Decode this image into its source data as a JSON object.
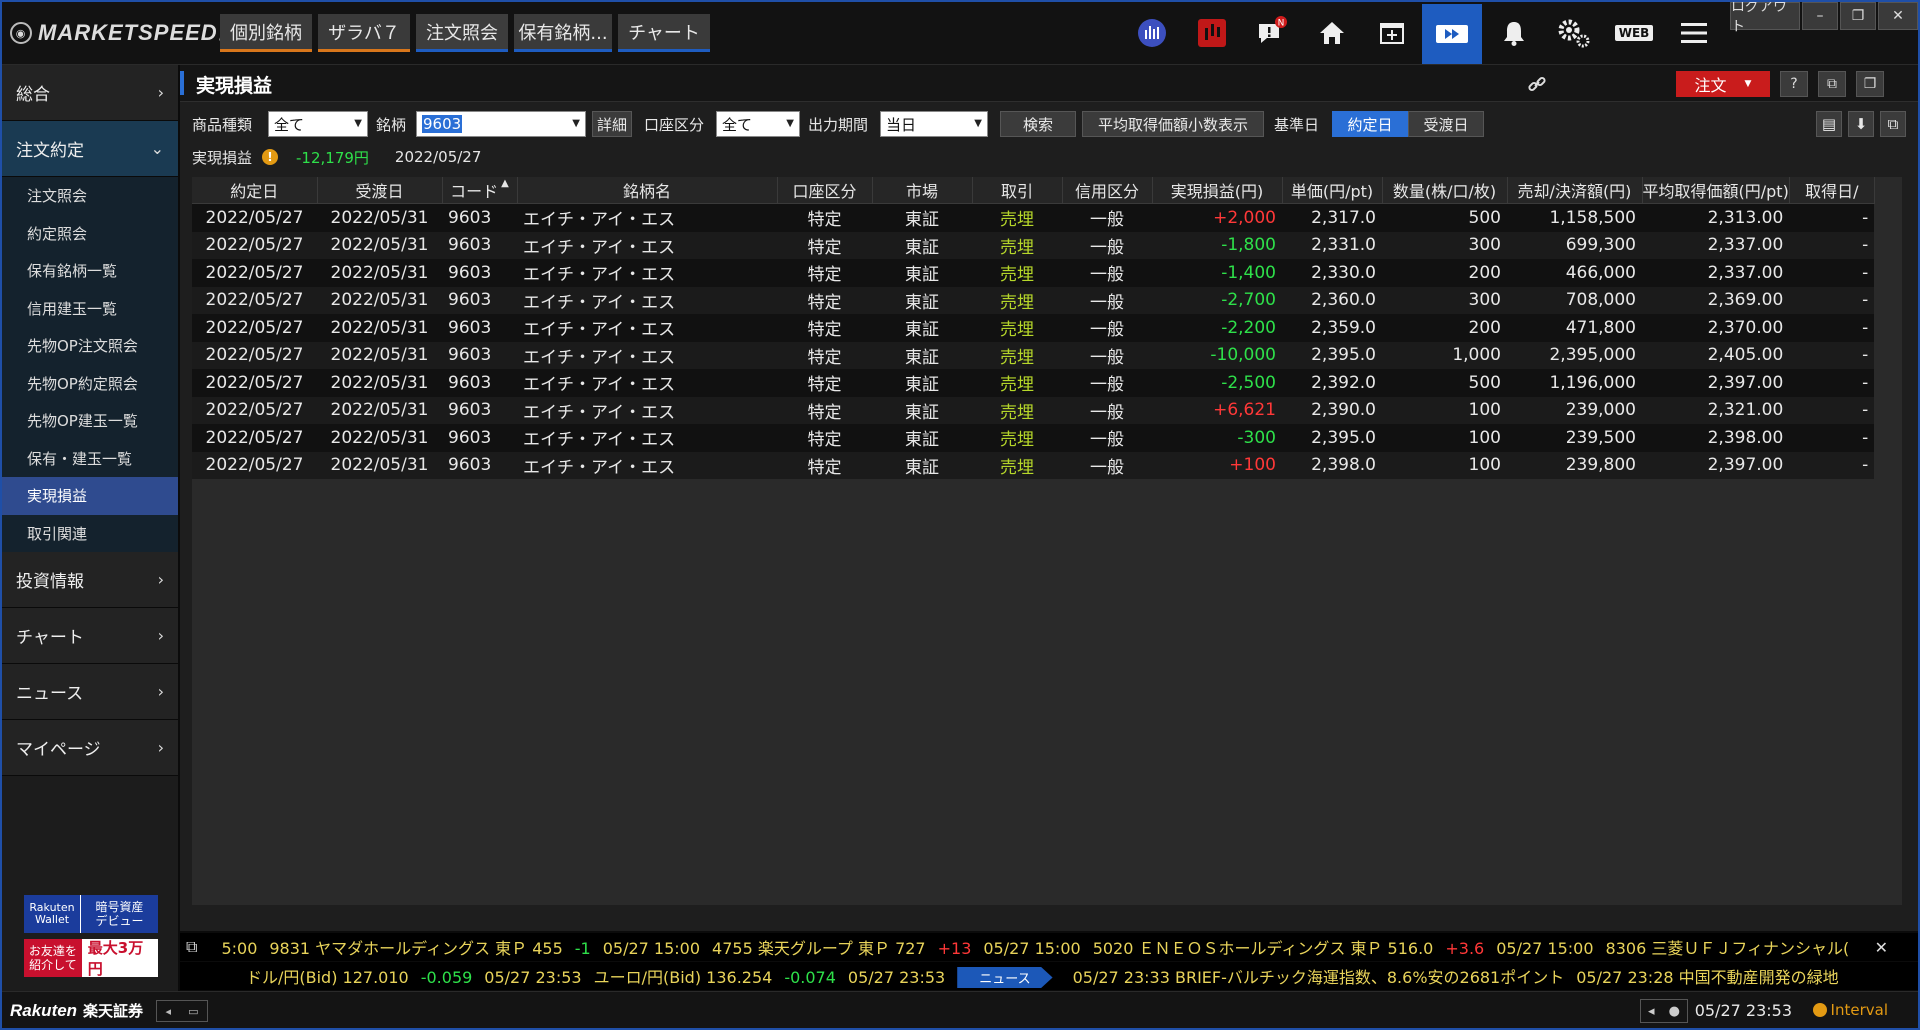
{
  "app": {
    "logo_text": "MARKETSPEEDⅡ",
    "tabs": [
      "個別銘柄",
      "ザラバ７",
      "注文照会",
      "保有銘柄...",
      "チャート"
    ],
    "logout_label": "ログアウト",
    "web_label": "WEB",
    "notification_badge": "N"
  },
  "sidebar": {
    "sections": [
      {
        "label": "総合"
      },
      {
        "label": "注文約定"
      },
      {
        "label": "投資情報"
      },
      {
        "label": "チャート"
      },
      {
        "label": "ニュース"
      },
      {
        "label": "マイページ"
      }
    ],
    "sub_items": [
      "注文照会",
      "約定照会",
      "保有銘柄一覧",
      "信用建玉一覧",
      "先物OP注文照会",
      "先物OP約定照会",
      "先物OP建玉一覧",
      "保有・建玉一覧",
      "実現損益",
      "取引関連"
    ],
    "active_sub": "実現損益",
    "banner1": {
      "brand_top": "Rakuten",
      "brand_bottom": "Wallet",
      "text_top": "暗号資産",
      "text_bottom": "デビュー"
    },
    "banner2": {
      "line1": "お友達を",
      "line2": "紹介して",
      "amount": "最大3万円"
    }
  },
  "panel": {
    "title": "実現損益",
    "order_button": "注文",
    "filters": {
      "product_label": "商品種類",
      "product_value": "全て",
      "symbol_label": "銘柄",
      "symbol_value": "9603",
      "detail_button": "詳細",
      "account_label": "口座区分",
      "account_value": "全て",
      "period_label": "出力期間",
      "period_value": "当日",
      "search_button": "検索",
      "avg_price_button": "平均取得価額小数表示",
      "base_date_label": "基準日",
      "trade_date_button": "約定日",
      "settle_date_button": "受渡日"
    },
    "summary": {
      "label": "実現損益",
      "value": "-12,179円",
      "date": "2022/05/27"
    }
  },
  "table": {
    "headers": [
      "約定日",
      "受渡日",
      "コード",
      "銘柄名",
      "口座区分",
      "市場",
      "取引",
      "信用区分",
      "実現損益(円)",
      "単価(円/pt)",
      "数量(株/口/枚)",
      "売却/決済額(円)",
      "平均取得価額(円/pt)",
      "取得日/"
    ],
    "rows": [
      [
        "2022/05/27",
        "2022/05/31",
        "9603",
        "エイチ・アイ・エス",
        "特定",
        "東証",
        "売埋",
        "一般",
        "+2,000",
        "2,317.0",
        "500",
        "1,158,500",
        "2,313.00",
        "-"
      ],
      [
        "2022/05/27",
        "2022/05/31",
        "9603",
        "エイチ・アイ・エス",
        "特定",
        "東証",
        "売埋",
        "一般",
        "-1,800",
        "2,331.0",
        "300",
        "699,300",
        "2,337.00",
        "-"
      ],
      [
        "2022/05/27",
        "2022/05/31",
        "9603",
        "エイチ・アイ・エス",
        "特定",
        "東証",
        "売埋",
        "一般",
        "-1,400",
        "2,330.0",
        "200",
        "466,000",
        "2,337.00",
        "-"
      ],
      [
        "2022/05/27",
        "2022/05/31",
        "9603",
        "エイチ・アイ・エス",
        "特定",
        "東証",
        "売埋",
        "一般",
        "-2,700",
        "2,360.0",
        "300",
        "708,000",
        "2,369.00",
        "-"
      ],
      [
        "2022/05/27",
        "2022/05/31",
        "9603",
        "エイチ・アイ・エス",
        "特定",
        "東証",
        "売埋",
        "一般",
        "-2,200",
        "2,359.0",
        "200",
        "471,800",
        "2,370.00",
        "-"
      ],
      [
        "2022/05/27",
        "2022/05/31",
        "9603",
        "エイチ・アイ・エス",
        "特定",
        "東証",
        "売埋",
        "一般",
        "-10,000",
        "2,395.0",
        "1,000",
        "2,395,000",
        "2,405.00",
        "-"
      ],
      [
        "2022/05/27",
        "2022/05/31",
        "9603",
        "エイチ・アイ・エス",
        "特定",
        "東証",
        "売埋",
        "一般",
        "-2,500",
        "2,392.0",
        "500",
        "1,196,000",
        "2,397.00",
        "-"
      ],
      [
        "2022/05/27",
        "2022/05/31",
        "9603",
        "エイチ・アイ・エス",
        "特定",
        "東証",
        "売埋",
        "一般",
        "+6,621",
        "2,390.0",
        "100",
        "239,000",
        "2,321.00",
        "-"
      ],
      [
        "2022/05/27",
        "2022/05/31",
        "9603",
        "エイチ・アイ・エス",
        "特定",
        "東証",
        "売埋",
        "一般",
        "-300",
        "2,395.0",
        "100",
        "239,500",
        "2,398.00",
        "-"
      ],
      [
        "2022/05/27",
        "2022/05/31",
        "9603",
        "エイチ・アイ・エス",
        "特定",
        "東証",
        "売埋",
        "一般",
        "+100",
        "2,398.0",
        "100",
        "239,800",
        "2,397.00",
        "-"
      ]
    ]
  },
  "ticker1": [
    {
      "text": "5:00"
    },
    {
      "text": "9831 ヤマダホールディングス 東Ｐ 455"
    },
    {
      "text": "-1",
      "kind": "neg"
    },
    {
      "text": "05/27 15:00"
    },
    {
      "text": "4755 楽天グループ 東Ｐ 727"
    },
    {
      "text": "+13",
      "kind": "pos"
    },
    {
      "text": "05/27 15:00"
    },
    {
      "text": "5020 ＥＮＥＯＳホールディングス 東Ｐ 516.0"
    },
    {
      "text": "+3.6",
      "kind": "pos"
    },
    {
      "text": "05/27 15:00"
    },
    {
      "text": "8306 三菱ＵＦＪフィナンシャル("
    }
  ],
  "ticker2": [
    {
      "text": "ドル/円(Bid) 127.010"
    },
    {
      "text": "-0.059",
      "kind": "neg"
    },
    {
      "text": "05/27 23:53"
    },
    {
      "text": "ユーロ/円(Bid) 136.254"
    },
    {
      "text": "-0.074",
      "kind": "neg"
    },
    {
      "text": "05/27 23:53"
    },
    {
      "text": "ニュース",
      "kind": "tag"
    },
    {
      "text": "05/27 23:33 BRIEF-バルチック海運指数、8.6%安の2681ポイント"
    },
    {
      "text": "05/27 23:28 中国不動産開発の緑地"
    }
  ],
  "status": {
    "brand": "Rakuten",
    "brand_jp": "楽天証券",
    "clock": "05/27 23:53",
    "interval": "Interval"
  },
  "colors": {
    "accent": "#1e5cc0",
    "positive": "#ff3838",
    "negative": "#2ee04a",
    "sell": "#b6d72a",
    "order": "#c91c1c"
  }
}
